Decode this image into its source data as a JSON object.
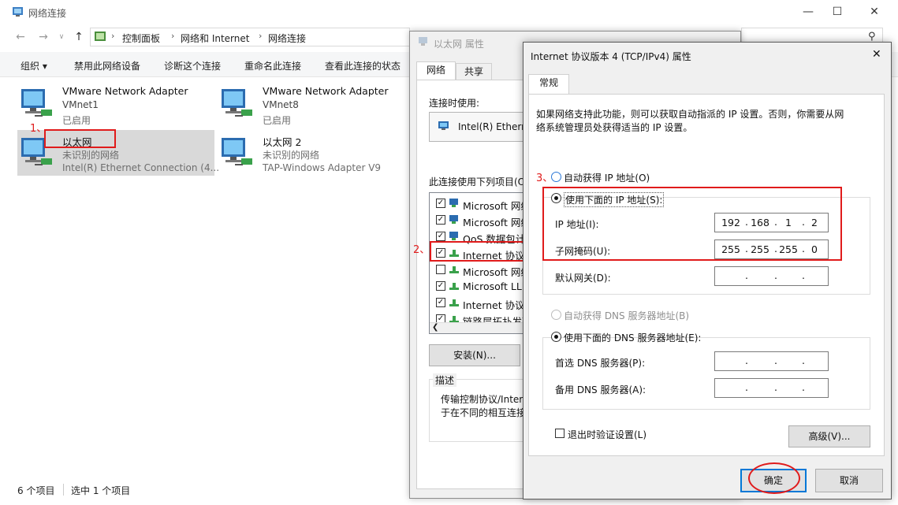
{
  "explorer": {
    "title": "网络连接",
    "breadcrumb": [
      "控制面板",
      "网络和 Internet",
      "网络连接"
    ],
    "toolbar": [
      "组织 ▾",
      "禁用此网络设备",
      "诊断这个连接",
      "重命名此连接",
      "查看此连接的状态"
    ],
    "adapters": [
      {
        "name": "VMware Network Adapter",
        "line2": "VMnet1",
        "line3": "已启用"
      },
      {
        "name": "VMware Network Adapter",
        "line2": "VMnet8",
        "line3": "已启用"
      },
      {
        "name": "以太网",
        "line2": "未识别的网络",
        "line3": "Intel(R) Ethernet Connection (4..."
      },
      {
        "name": "以太网 2",
        "line2": "未识别的网络",
        "line3": "TAP-Windows Adapter V9"
      }
    ],
    "status_count": "6 个项目",
    "status_selected": "选中 1 个项目"
  },
  "annotations": {
    "step1": "1、",
    "step2": "2、",
    "step3": "3、",
    "accent": "#e01b1b"
  },
  "eth_dialog": {
    "title": "以太网 属性",
    "tabs": [
      "网络",
      "共享"
    ],
    "connect_using_label": "连接时使用:",
    "adapter_name": "Intel(R) Etherne",
    "items_label": "此连接使用下列项目(O",
    "items": [
      {
        "checked": true,
        "text": "Microsoft 网络"
      },
      {
        "checked": true,
        "text": "Microsoft 网络"
      },
      {
        "checked": true,
        "text": "QoS 数据包计"
      },
      {
        "checked": true,
        "text": "Internet 协议"
      },
      {
        "checked": false,
        "text": "Microsoft 网络"
      },
      {
        "checked": true,
        "text": "Microsoft LLD"
      },
      {
        "checked": true,
        "text": "Internet 协议版"
      },
      {
        "checked": true,
        "text": "链路层拓扑发现"
      }
    ],
    "install_button": "安装(N)...",
    "description_label": "描述",
    "description_text": [
      "传输控制协议/Inter",
      "于在不同的相互连接"
    ]
  },
  "ipv4_dialog": {
    "title": "Internet 协议版本 4 (TCP/IPv4) 属性",
    "tab": "常规",
    "intro": [
      "如果网络支持此功能，则可以获取自动指派的 IP 设置。否则，你需要从网",
      "络系统管理员处获得适当的 IP 设置。"
    ],
    "auto_ip_label": "自动获得 IP 地址(O)",
    "manual_ip_label": "使用下面的 IP 地址(S):",
    "ip_label": "IP 地址(I):",
    "ip_value": [
      "192",
      "168",
      "1",
      "2"
    ],
    "mask_label": "子网掩码(U):",
    "mask_value": [
      "255",
      "255",
      "255",
      "0"
    ],
    "gateway_label": "默认网关(D):",
    "auto_dns_label": "自动获得 DNS 服务器地址(B)",
    "manual_dns_label": "使用下面的 DNS 服务器地址(E):",
    "preferred_dns_label": "首选 DNS 服务器(P):",
    "alternate_dns_label": "备用 DNS 服务器(A):",
    "validate_label": "退出时验证设置(L)",
    "advanced_button": "高级(V)...",
    "ok_button": "确定",
    "cancel_button": "取消"
  }
}
